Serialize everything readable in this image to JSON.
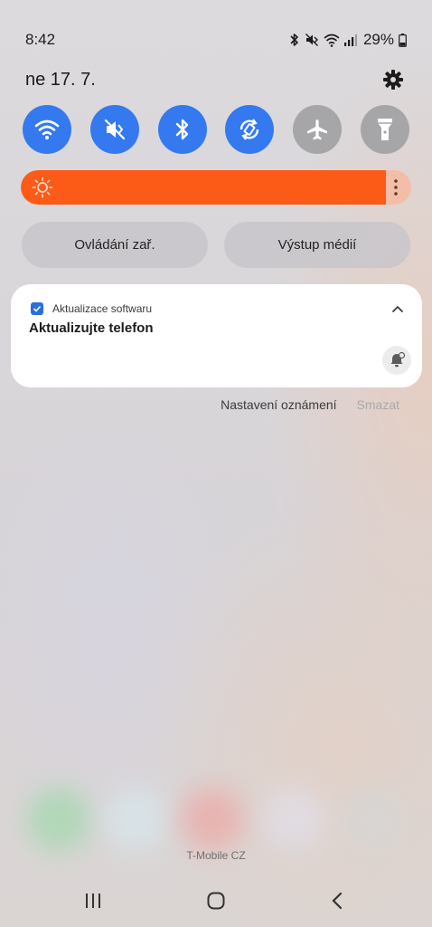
{
  "status_bar": {
    "time": "8:42",
    "battery_percent": "29%",
    "icons": [
      "bluetooth-icon",
      "mute-icon",
      "wifi-icon",
      "signal-icon",
      "battery-icon"
    ]
  },
  "header": {
    "date": "ne 17. 7.",
    "settings_icon": "gear-icon"
  },
  "quick_settings": [
    {
      "id": "wifi",
      "icon": "wifi-icon",
      "state": "on"
    },
    {
      "id": "sound",
      "icon": "mute-icon",
      "state": "on"
    },
    {
      "id": "bluetooth",
      "icon": "bluetooth-icon",
      "state": "on"
    },
    {
      "id": "autorotate",
      "icon": "autorotate-icon",
      "state": "on"
    },
    {
      "id": "airplane",
      "icon": "airplane-icon",
      "state": "off"
    },
    {
      "id": "flashlight",
      "icon": "flashlight-icon",
      "state": "off"
    }
  ],
  "brightness": {
    "level": 0.935,
    "fill_color": "#fc5a17",
    "track_color": "#f4bda7"
  },
  "pills": {
    "devices_label": "Ovládání zař.",
    "media_label": "Výstup médií"
  },
  "notification": {
    "app_name": "Aktualizace softwaru",
    "title": "Aktualizujte telefon",
    "accent_color": "#2b6fdb"
  },
  "notification_actions": {
    "settings_label": "Nastavení oznámení",
    "clear_label": "Smazat"
  },
  "carrier": "T-Mobile CZ",
  "navbar": {
    "icons": [
      "recents-icon",
      "home-icon",
      "back-icon"
    ]
  },
  "colors": {
    "qs_on": "#3479f0",
    "qs_off": "#a6a5a8"
  }
}
